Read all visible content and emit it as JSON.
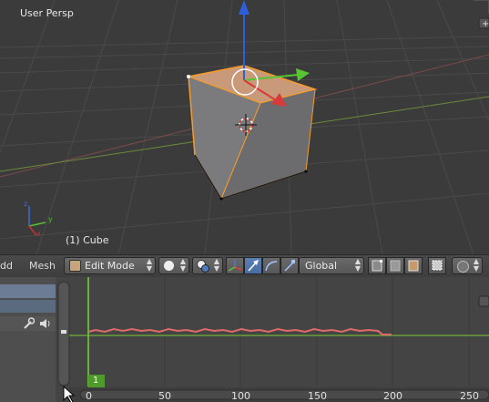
{
  "viewport": {
    "view_label": "User Persp",
    "object_label": "(1) Cube",
    "axis_x": "x",
    "axis_y": "y",
    "axis_z": "z"
  },
  "header": {
    "menu_add_partial": "dd",
    "menu_mesh": "Mesh",
    "mode_select": "Edit Mode",
    "orientation_select": "Global",
    "icons": [
      "editor-type-icon",
      "viewport-shading-icon",
      "pivot-point-icon",
      "manipulator-toggle-icon",
      "translate-manipulator-icon",
      "rotate-manipulator-icon",
      "scale-manipulator-icon",
      "vertex-select-icon",
      "edge-select-icon",
      "face-select-icon",
      "occlude-geometry-icon",
      "proportional-editing-icon"
    ]
  },
  "timeline": {
    "current_frame": "1",
    "ticks": [
      "0",
      "50",
      "100",
      "150",
      "200",
      "250"
    ],
    "channel_icons": [
      "wrench-icon",
      "speaker-icon"
    ]
  }
}
